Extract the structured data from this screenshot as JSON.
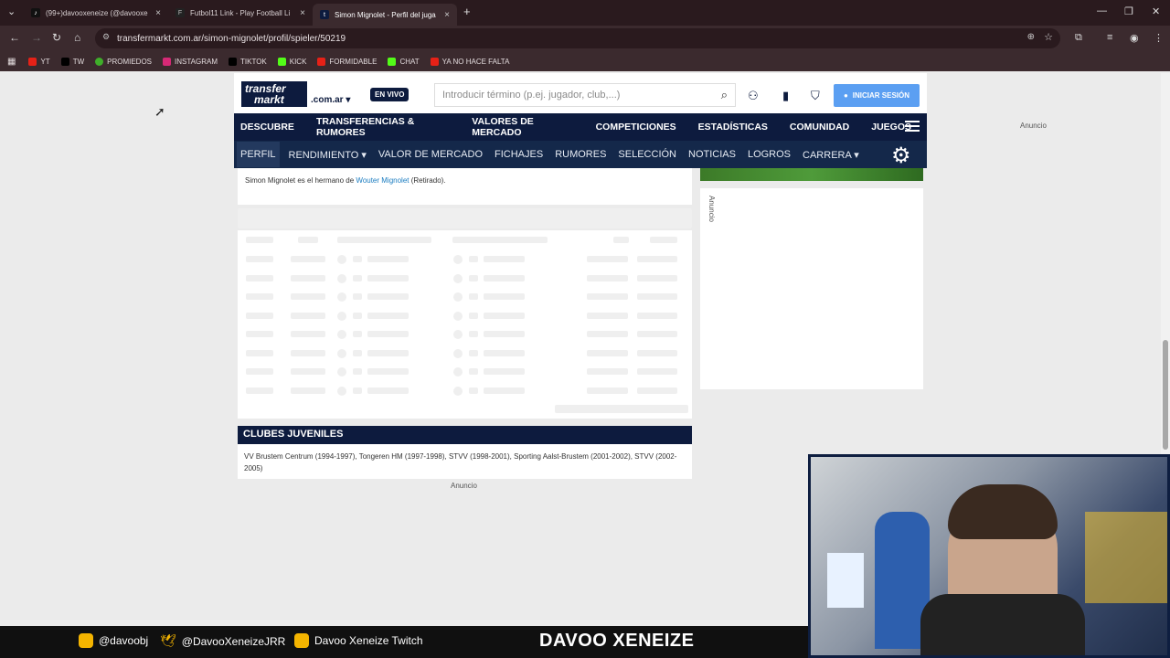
{
  "browser": {
    "tabs": [
      {
        "title": "(99+)davooxeneize (@davooxe",
        "active": false
      },
      {
        "title": "Futbol11 Link - Play Football Li",
        "active": false
      },
      {
        "title": "Simon Mignolet - Perfil del juga",
        "active": true
      }
    ],
    "url": "transfermarkt.com.ar/simon-mignolet/profil/spieler/50219",
    "bookmarks": [
      {
        "label": "YT",
        "icon": "youtube-icon",
        "color": "#e62117"
      },
      {
        "label": "TW",
        "icon": "x-icon",
        "color": "#000000"
      },
      {
        "label": "PROMIEDOS",
        "icon": "ball-icon",
        "color": "#3fae2a"
      },
      {
        "label": "INSTAGRAM",
        "icon": "instagram-icon",
        "color": "#d62976"
      },
      {
        "label": "TIKTOK",
        "icon": "tiktok-icon",
        "color": "#000000"
      },
      {
        "label": "KICK",
        "icon": "kick-icon",
        "color": "#53fc18"
      },
      {
        "label": "FORMIDABLE",
        "icon": "youtube-icon",
        "color": "#e62117"
      },
      {
        "label": "CHAT",
        "icon": "kick-icon",
        "color": "#53fc18"
      },
      {
        "label": "YA NO HACE FALTA",
        "icon": "youtube-icon",
        "color": "#e62117"
      }
    ]
  },
  "site": {
    "logo_line1": "transfer",
    "logo_line2": "markt",
    "tld": ".com.ar",
    "live_label": "EN VIVO",
    "search_placeholder": "Introducir término (p.ej. jugador, club,...)",
    "login_label": "INICIAR SESIÓN",
    "main_nav": [
      "DESCUBRE",
      "TRANSFERENCIAS & RUMORES",
      "VALORES DE MERCADO",
      "COMPETICIONES",
      "ESTADÍSTICAS",
      "COMUNIDAD",
      "JUEGOS"
    ],
    "sub_nav": [
      "PERFIL",
      "RENDIMIENTO ▾",
      "VALOR DE MERCADO",
      "FICHAJES",
      "RUMORES",
      "SELECCIÓN",
      "NOTICIAS",
      "LOGROS",
      "CARRERA ▾"
    ],
    "notice_prefix": "Simon Mignolet es el hermano de ",
    "notice_link": "Wouter Mignolet",
    "notice_suffix": " (Retirado).",
    "youth_title": "CLUBES JUVENILES",
    "youth_text": "VV Brustem Centrum (1994-1997), Tongeren HM (1997-1998), STVV (1998-2001), Sporting Aalst-Brustem (2001-2002), STVV (2002-2005)",
    "ad_label": "Anuncio"
  },
  "stream": {
    "instagram": "@davoobj",
    "twitter": "@DavooXeneizeJRR",
    "twitch": "Davoo Xeneize Twitch",
    "brand": "DAVOO XENEIZE"
  }
}
